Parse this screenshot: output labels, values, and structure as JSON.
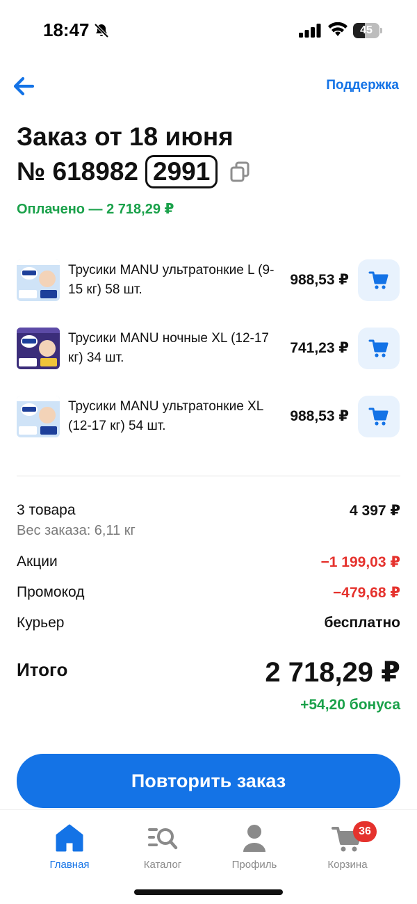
{
  "status_bar": {
    "time": "18:47",
    "battery": "45",
    "battery_level": 0.45
  },
  "header": {
    "support_label": "Поддержка"
  },
  "order": {
    "title_line1": "Заказ от 18 июня",
    "number_prefix": "№ 618982",
    "number_code": "2991",
    "paid_status": "Оплачено — 2 718,29 ₽"
  },
  "items": [
    {
      "name": "Трусики MANU ультратонкие L (9-15 кг) 58 шт.",
      "price": "988,53 ₽"
    },
    {
      "name": "Трусики MANU ночные XL (12-17 кг) 34 шт.",
      "price": "741,23 ₽"
    },
    {
      "name": "Трусики MANU ультратонкие XL (12-17 кг) 54 шт.",
      "price": "988,53 ₽"
    }
  ],
  "summary": {
    "goods_label": "3 товара",
    "goods_value": "4 397 ₽",
    "weight_label": "Вес заказа: 6,11 кг",
    "promo_label": "Акции",
    "promo_value": "−1 199,03 ₽",
    "code_label": "Промокод",
    "code_value": "−479,68 ₽",
    "courier_label": "Курьер",
    "courier_value": "бесплатно",
    "total_label": "Итого",
    "total_value": "2 718,29 ₽",
    "bonus": "+54,20 бонуса"
  },
  "actions": {
    "repeat_label": "Повторить заказ"
  },
  "tabbar": {
    "home": "Главная",
    "catalog": "Каталог",
    "profile": "Профиль",
    "cart": "Корзина",
    "cart_count": "36"
  },
  "colors": {
    "accent": "#1473e6",
    "success": "#1aa14a",
    "danger": "#e5322d"
  }
}
